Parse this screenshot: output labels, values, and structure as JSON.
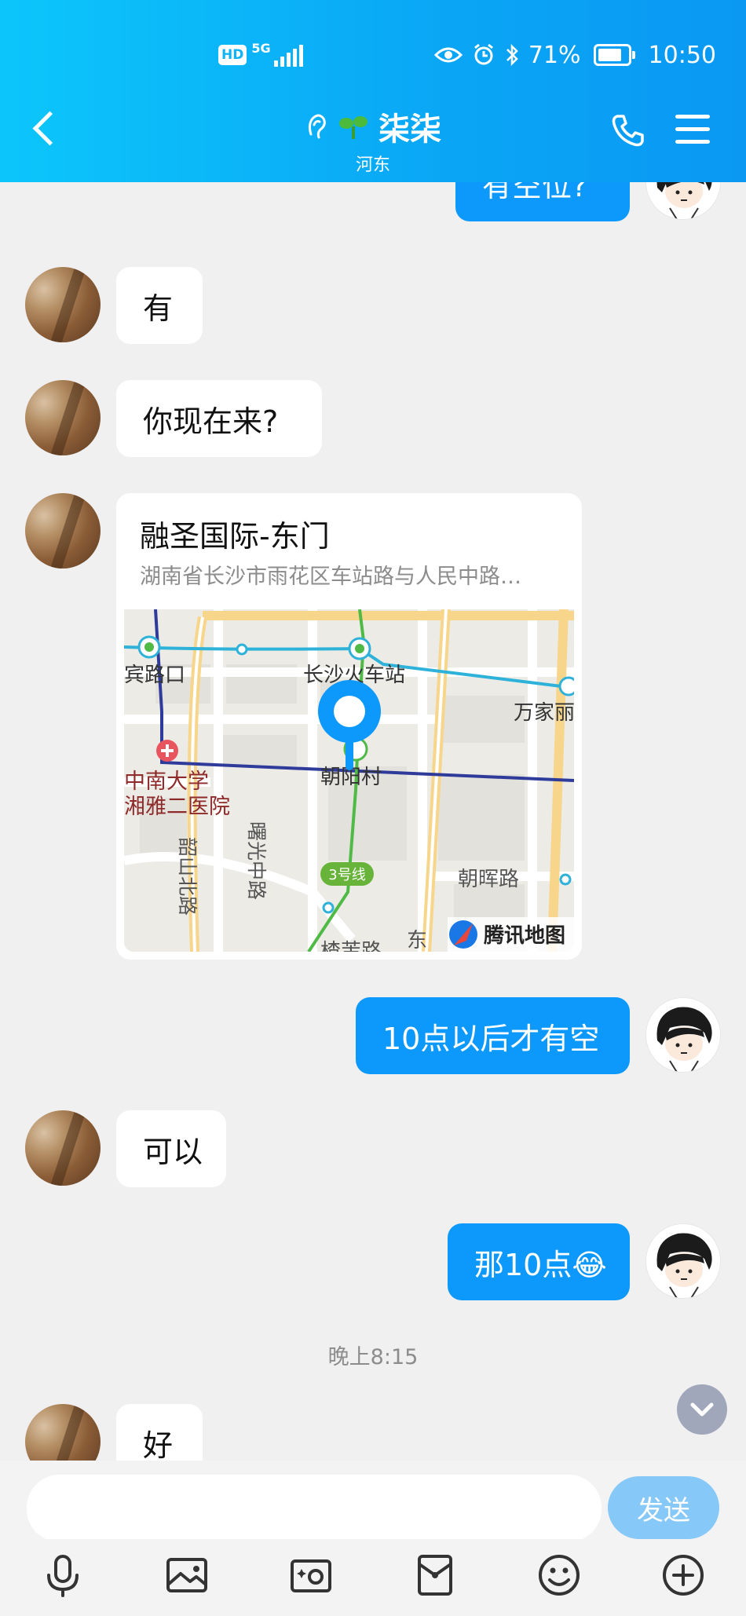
{
  "status_bar": {
    "network_badge": "HD",
    "network_type": "5G",
    "battery_percent": "71%",
    "time": "10:50"
  },
  "header": {
    "title": "柒柒",
    "subtitle": "河东"
  },
  "messages": [
    {
      "side": "out",
      "type": "text",
      "text": "有空位?"
    },
    {
      "side": "in",
      "type": "text",
      "text": "有"
    },
    {
      "side": "in",
      "type": "text",
      "text": "你现在来?"
    },
    {
      "side": "in",
      "type": "location",
      "title": "融圣国际-东门",
      "address": "湖南省长沙市雨花区车站路与人民中路…"
    },
    {
      "side": "out",
      "type": "text",
      "text": "10点以后才有空"
    },
    {
      "side": "in",
      "type": "text",
      "text": "可以"
    },
    {
      "side": "out",
      "type": "text",
      "text": "那10点😂"
    },
    {
      "type": "timestamp",
      "text": "晚上8:15"
    },
    {
      "side": "in",
      "type": "text",
      "text": "好"
    }
  ],
  "map": {
    "labels": {
      "binlu": "宾路口",
      "station": "长沙火车站",
      "wanjia": "万家丽",
      "hospital_1": "中南大学",
      "hospital_2": "湘雅二医院",
      "chaoyangcun": "朝阳村",
      "shuguang": "曙光中路",
      "shaoshan": "韶山北路",
      "line3": "3号线",
      "zhaohui": "朝晖路",
      "east": "东",
      "bottom_road": "楂芾路",
      "provider": "腾讯地图"
    }
  },
  "input": {
    "placeholder": "",
    "send_label": "发送"
  },
  "toolbar_icons": [
    "microphone-icon",
    "image-icon",
    "camera-icon",
    "red-packet-icon",
    "emoji-icon",
    "plus-icon"
  ],
  "colors": {
    "header": "#0aa6f5",
    "outgoing_bubble": "#0d99fc",
    "incoming_bubble": "#ffffff",
    "send_button": "#86c8f8",
    "background": "#f0f0f0"
  }
}
